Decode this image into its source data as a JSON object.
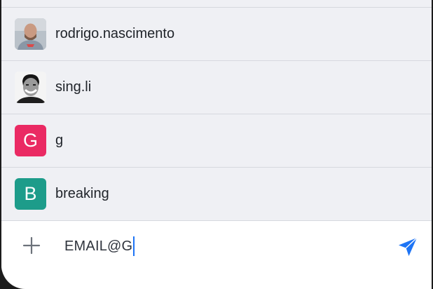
{
  "suggestions": [
    {
      "label": "rodrigo.nascimento",
      "avatar": "photo-bald-man-icon"
    },
    {
      "label": "sing.li",
      "avatar": "photo-smiling-man-icon"
    },
    {
      "label": "g",
      "avatar_letter": "G",
      "avatar_color": "#ea2a63"
    },
    {
      "label": "breaking",
      "avatar_letter": "B",
      "avatar_color": "#1d9c8a"
    }
  ],
  "composer": {
    "input_value": "EMAIL@G",
    "add_icon": "plus-icon",
    "send_icon": "send-icon",
    "accent_color": "#1d74f5"
  }
}
